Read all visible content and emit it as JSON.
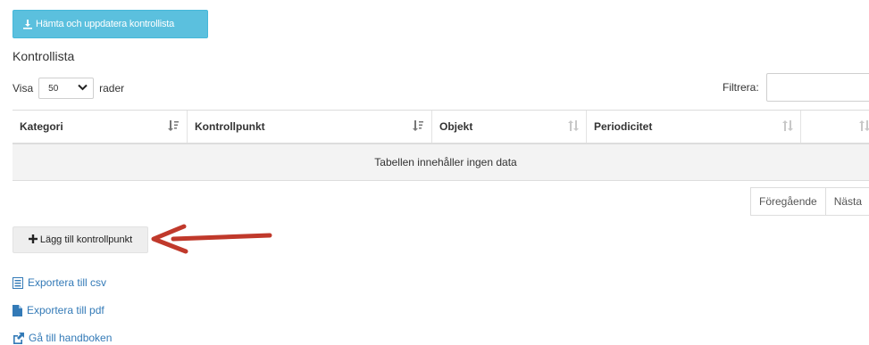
{
  "actions": {
    "fetch_button": "Hämta och uppdatera kontrollista",
    "add_button": "Lägg till kontrollpunkt"
  },
  "heading": "Kontrollista",
  "length_menu": {
    "show_label": "Visa",
    "selected": "50",
    "rows_label": "rader"
  },
  "filter": {
    "label": "Filtrera:",
    "value": ""
  },
  "table": {
    "columns": [
      "Kategori",
      "Kontrollpunkt",
      "Objekt",
      "Periodicitet"
    ],
    "empty_message": "Tabellen innehåller ingen data"
  },
  "pagination": {
    "previous": "Föregående",
    "next": "Nästa"
  },
  "links": {
    "csv": "Exportera till csv",
    "pdf": "Exportera till pdf",
    "handbook": "Gå till handboken"
  },
  "colors": {
    "info_button": "#5bc0de",
    "link": "#337ab7",
    "annotation_arrow": "#c0392b"
  },
  "icons": [
    "download-icon",
    "sort-icon",
    "chevron-down-icon",
    "plus-icon",
    "list-icon",
    "file-icon",
    "external-link-icon",
    "annotation-arrow"
  ]
}
